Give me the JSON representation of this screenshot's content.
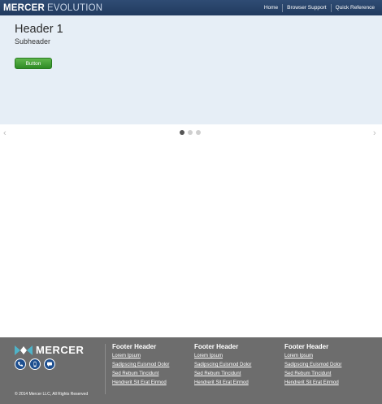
{
  "header": {
    "brand_primary": "MERCER",
    "brand_secondary": "EVOLUTION",
    "nav": [
      "Home",
      "Browser Support",
      "Quick Reference"
    ]
  },
  "hero": {
    "title": "Header 1",
    "subtitle": "Subheader",
    "button_label": "Button"
  },
  "carousel": {
    "prev_glyph": "‹",
    "next_glyph": "›",
    "slide_count": 3,
    "active_index": 0
  },
  "footer": {
    "logo_text": "MERCER",
    "copyright": "© 2014 Mercer LLC, All Rights Reserved",
    "social_icons": [
      "phone-icon",
      "mobile-icon",
      "chat-icon"
    ],
    "columns": [
      {
        "header": "Footer Header",
        "links": [
          "Lorem Ipsum",
          "Sadipscing Euismod Dolor",
          "Sed Rebum Tincidunt",
          "Hendrerit Sit Erat Eirmod"
        ]
      },
      {
        "header": "Footer Header",
        "links": [
          "Lorem Ipsum",
          "Sadipscing Euismod Dolor",
          "Sed Rebum Tincidunt",
          "Hendrerit Sit Erat Eirmod"
        ]
      },
      {
        "header": "Footer Header",
        "links": [
          "Lorem Ipsum",
          "Sadipscing Euismod Dolor",
          "Sed Rebum Tincidunt",
          "Hendrerit Sit Erat Eirmod"
        ]
      }
    ]
  },
  "colors": {
    "topbar": "#2a4468",
    "hero_bg": "#e6eef6",
    "button_green": "#3d9a31",
    "footer_bg": "#6d6d6d",
    "social_blue": "#1e4f8f"
  }
}
